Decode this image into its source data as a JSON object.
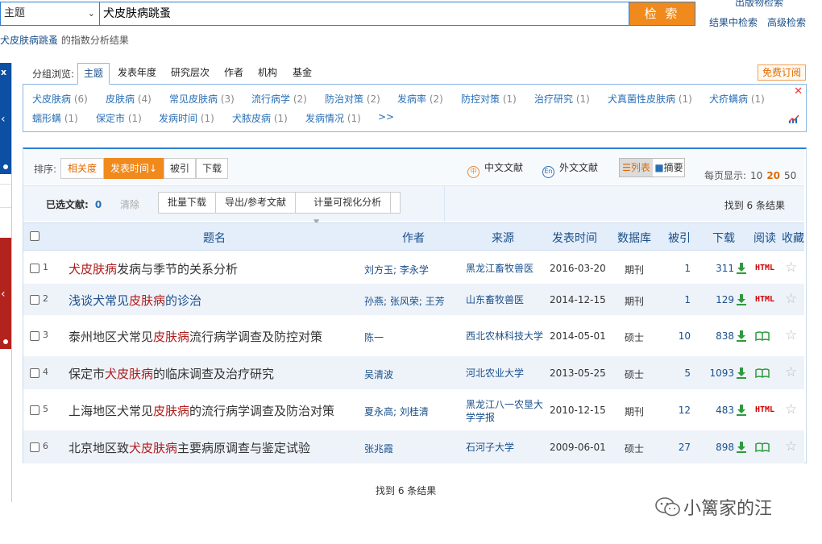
{
  "search": {
    "field": "主题",
    "query": "犬皮肤病跳蚤",
    "button": "检 索",
    "links": [
      "出版物检索",
      "结果中检索",
      "高级检索"
    ],
    "index_keyword": "犬皮肤病跳蚤",
    "index_suffix": "的指数分析结果"
  },
  "group": {
    "label": "分组浏览:",
    "tabs": [
      "主题",
      "发表年度",
      "研究层次",
      "作者",
      "机构",
      "基金"
    ],
    "subscribe": "免费订阅",
    "row1": [
      {
        "t": "犬皮肤病",
        "n": "(6)"
      },
      {
        "t": "皮肤病",
        "n": "(4)"
      },
      {
        "t": "常见皮肤病",
        "n": "(3)"
      },
      {
        "t": "流行病学",
        "n": "(2)"
      },
      {
        "t": "防治对策",
        "n": "(2)"
      },
      {
        "t": "发病率",
        "n": "(2)"
      },
      {
        "t": "防控对策",
        "n": "(1)"
      },
      {
        "t": "治疗研究",
        "n": "(1)"
      },
      {
        "t": "犬真菌性皮肤病",
        "n": "(1)"
      },
      {
        "t": "犬疥螨病",
        "n": "(1)"
      }
    ],
    "row2": [
      {
        "t": "蠕形螨",
        "n": "(1)"
      },
      {
        "t": "保定市",
        "n": "(1)"
      },
      {
        "t": "发病时间",
        "n": "(1)"
      },
      {
        "t": "犬脓皮病",
        "n": "(1)"
      },
      {
        "t": "发病情况",
        "n": "(1)"
      },
      {
        "t": ">>",
        "n": ""
      }
    ]
  },
  "sort": {
    "label": "排序:",
    "options": [
      "相关度",
      "发表时间",
      "被引",
      "下载"
    ],
    "cn": "中文文献",
    "en": "外文文献",
    "view_list": "列表",
    "view_abs": "摘要",
    "per_page_label": "每页显示:",
    "per_page": [
      "10",
      "20",
      "50"
    ]
  },
  "selected": {
    "label": "已选文献:",
    "count": "0",
    "clear": "清除",
    "buttons": [
      "批量下载",
      "导出/参考文献",
      "计量可视化分析"
    ],
    "found": "找到 6 条结果"
  },
  "table": {
    "headers": [
      "题名",
      "作者",
      "来源",
      "发表时间",
      "数据库",
      "被引",
      "下载",
      "阅读",
      "收藏"
    ],
    "rows": [
      {
        "no": "1",
        "title": [
          [
            "犬皮肤病",
            true
          ],
          [
            "发病与季节的关系分析",
            false
          ]
        ],
        "author": "刘方玉; 李永学",
        "source": "黑龙江畜牧兽医",
        "date": "2016-03-20",
        "db": "期刊",
        "cite": "1",
        "dl": "311",
        "read": "HTML"
      },
      {
        "no": "2",
        "title": [
          [
            "浅谈犬常见",
            false
          ],
          [
            "皮肤病",
            true
          ],
          [
            "的诊治",
            false
          ]
        ],
        "author": "孙燕; 张风荣; 王芳",
        "source": "山东畜牧兽医",
        "date": "2014-12-15",
        "db": "期刊",
        "cite": "1",
        "dl": "129",
        "read": "HTML"
      },
      {
        "no": "3",
        "title": [
          [
            "泰州地区犬常见",
            false
          ],
          [
            "皮肤病",
            true
          ],
          [
            "流行病学调查及防控对策",
            false
          ]
        ],
        "author": "陈一",
        "source": "西北农林科技大学",
        "date": "2014-05-01",
        "db": "硕士",
        "cite": "10",
        "dl": "838",
        "read": "book"
      },
      {
        "no": "4",
        "title": [
          [
            "保定市",
            false
          ],
          [
            "犬皮肤病",
            true
          ],
          [
            "的临床调查及治疗研究",
            false
          ]
        ],
        "author": "吴清波",
        "source": "河北农业大学",
        "date": "2013-05-25",
        "db": "硕士",
        "cite": "5",
        "dl": "1093",
        "read": "book"
      },
      {
        "no": "5",
        "title": [
          [
            "上海地区犬常见",
            false
          ],
          [
            "皮肤病",
            true
          ],
          [
            "的流行病学调查及防治对策",
            false
          ]
        ],
        "author": "夏永高; 刘桂清",
        "source": "黑龙江八一农垦大学学报",
        "date": "2010-12-15",
        "db": "期刊",
        "cite": "12",
        "dl": "483",
        "read": "HTML"
      },
      {
        "no": "6",
        "title": [
          [
            "北京地区致",
            false
          ],
          [
            "犬皮肤病",
            true
          ],
          [
            "主要病原调查与鉴定试验",
            false
          ]
        ],
        "author": "张兆霞",
        "source": "石河子大学",
        "date": "2009-06-01",
        "db": "硕士",
        "cite": "27",
        "dl": "898",
        "read": "book"
      }
    ]
  },
  "footer": {
    "found": "找到 6 条结果"
  },
  "watermark": "小篱家的汪",
  "colors": {
    "accent": "#f08a1c",
    "link": "#1a4f8a",
    "highlight": "#b01c1c",
    "border": "#2d7fd2"
  }
}
